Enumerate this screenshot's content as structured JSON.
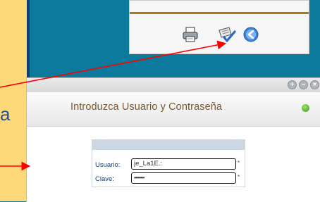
{
  "login": {
    "title": "Introduzca Usuario y Contraseña",
    "username_label": "Usuario:",
    "username_value": "je_La1E.:",
    "password_label": "Clave:",
    "password_value": "••••••••",
    "required_mark": "*"
  },
  "side_text": "a",
  "toolbar": {
    "icons": [
      "printer-icon",
      "edit-check-icon",
      "back-arrow-icon"
    ]
  },
  "window_controls": [
    "plus",
    "minus",
    "close"
  ],
  "colors": {
    "background": "#0b7a9c",
    "side_panel": "#fdd97a",
    "arrow": "#ff0000",
    "title_text": "#7a5630"
  }
}
